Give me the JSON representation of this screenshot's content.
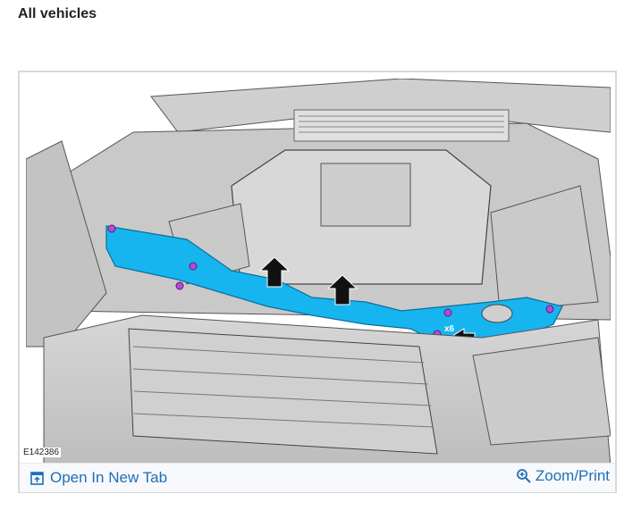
{
  "header": {
    "title": "All vehicles"
  },
  "figure": {
    "id_label": "E142386",
    "callout": "x6",
    "colors": {
      "highlight": "#16b5f0",
      "fastener": "#b44bd6"
    },
    "icons": [
      "arrow-up-icon",
      "arrow-up-icon",
      "arrow-left-icon"
    ]
  },
  "footer": {
    "open_label": "Open In New Tab",
    "zoom_label": "Zoom/Print",
    "link_color": "#1f6fb5"
  }
}
